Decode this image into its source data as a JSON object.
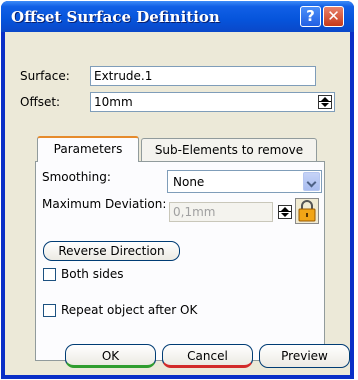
{
  "window": {
    "title": "Offset Surface Definition"
  },
  "titlebar": {
    "help_glyph": "?",
    "close_glyph": "✕"
  },
  "form": {
    "surface_label": "Surface:",
    "surface_value": "Extrude.1",
    "offset_label": "Offset:",
    "offset_value": "10mm"
  },
  "tabs": [
    {
      "label": "Parameters",
      "active": true
    },
    {
      "label": "Sub-Elements to remove",
      "active": false
    }
  ],
  "parameters": {
    "smoothing_label": "Smoothing:",
    "smoothing_value": "None",
    "max_deviation_label": "Maximum Deviation:",
    "max_deviation_value": "0,1mm",
    "reverse_direction_label": "Reverse Direction",
    "both_sides_label": "Both sides",
    "both_sides_checked": false,
    "repeat_label": "Repeat object after OK",
    "repeat_checked": false
  },
  "buttons": {
    "ok": "OK",
    "cancel": "Cancel",
    "preview": "Preview"
  },
  "colors": {
    "title_bar": "#0654db",
    "dialog_bg": "#ece9d8",
    "ok_accent": "#2f9d2f",
    "cancel_accent": "#d22a2a",
    "tab_highlight": "#e68b2c"
  }
}
